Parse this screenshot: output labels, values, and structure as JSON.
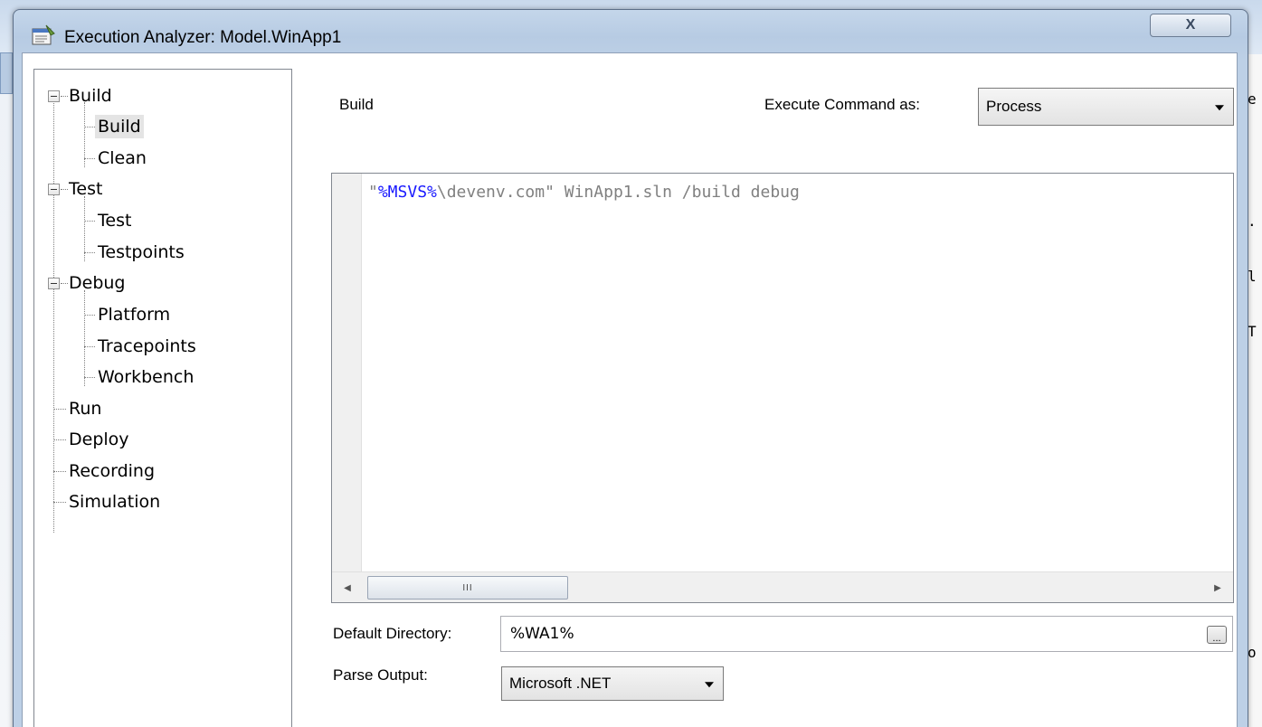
{
  "window": {
    "title": "Execution Analyzer: Model.WinApp1",
    "close_glyph": "X"
  },
  "tree": {
    "groups": [
      {
        "label": "Build",
        "expanded": true,
        "children": [
          {
            "label": "Build",
            "selected": true
          },
          {
            "label": "Clean"
          }
        ]
      },
      {
        "label": "Test",
        "expanded": true,
        "children": [
          {
            "label": "Test"
          },
          {
            "label": "Testpoints"
          }
        ]
      },
      {
        "label": "Debug",
        "expanded": true,
        "children": [
          {
            "label": "Platform"
          },
          {
            "label": "Tracepoints"
          },
          {
            "label": "Workbench"
          }
        ]
      },
      {
        "label": "Run"
      },
      {
        "label": "Deploy"
      },
      {
        "label": "Recording"
      },
      {
        "label": "Simulation"
      }
    ]
  },
  "main": {
    "section_title": "Build",
    "execute_label": "Execute Command as:",
    "execute_value": "Process",
    "command": {
      "quote_open": "\"",
      "variable": "%MSVS%",
      "rest": "\\devenv.com\" WinApp1.sln /build debug"
    },
    "scroll_thumb_glyph": "III",
    "default_dir_label": "Default Directory:",
    "default_dir_value": "%WA1%",
    "browse_label": "...",
    "parse_output_label": "Parse Output:",
    "parse_output_value": "Microsoft .NET"
  },
  "background_glyphs": [
    "e",
    ".",
    "l",
    "T",
    "o"
  ],
  "colors": {
    "accent_var": "#1a1aff",
    "code_text": "#808080"
  }
}
